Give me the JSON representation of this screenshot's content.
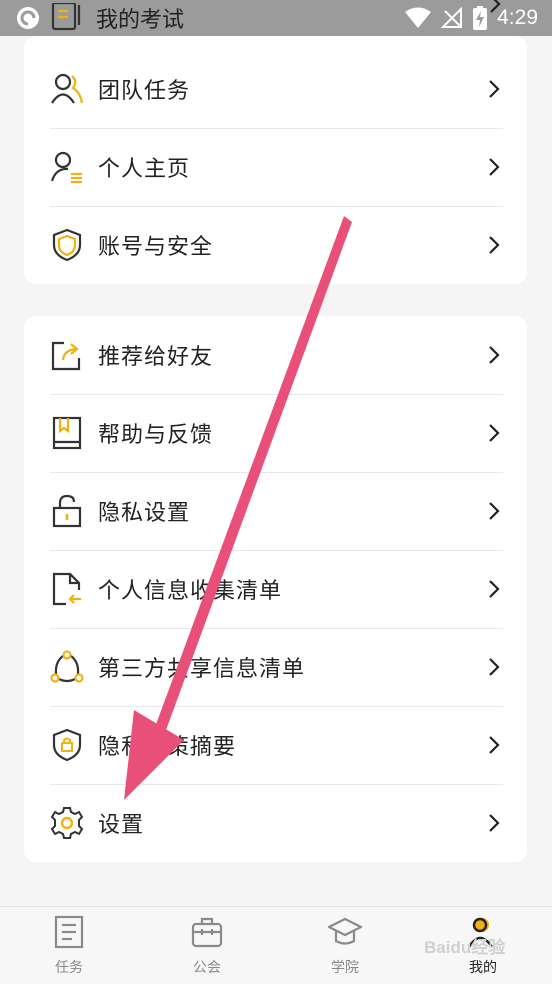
{
  "status_bar": {
    "time": "4:29"
  },
  "top_partial_item": {
    "label": "我的考试",
    "icon": "exam-icon"
  },
  "card1": {
    "items": [
      {
        "label": "团队任务",
        "icon": "team-icon"
      },
      {
        "label": "个人主页",
        "icon": "profile-icon"
      },
      {
        "label": "账号与安全",
        "icon": "shield-icon"
      }
    ]
  },
  "card2": {
    "items": [
      {
        "label": "推荐给好友",
        "icon": "share-icon"
      },
      {
        "label": "帮助与反馈",
        "icon": "book-icon"
      },
      {
        "label": "隐私设置",
        "icon": "lock-icon"
      },
      {
        "label": "个人信息收集清单",
        "icon": "document-icon"
      },
      {
        "label": "第三方共享信息清单",
        "icon": "network-icon"
      },
      {
        "label": "隐私政策摘要",
        "icon": "privacy-shield-icon"
      },
      {
        "label": "设置",
        "icon": "gear-icon"
      }
    ]
  },
  "tab_bar": {
    "tabs": [
      {
        "label": "任务",
        "icon": "task-icon"
      },
      {
        "label": "公会",
        "icon": "guild-icon"
      },
      {
        "label": "学院",
        "icon": "academy-icon"
      },
      {
        "label": "我的",
        "icon": "me-icon",
        "active": true
      }
    ]
  },
  "colors": {
    "accent": "#f2b10d",
    "arrow": "#e8507a",
    "icon_stroke": "#333333"
  },
  "watermark": "Baidu经验"
}
